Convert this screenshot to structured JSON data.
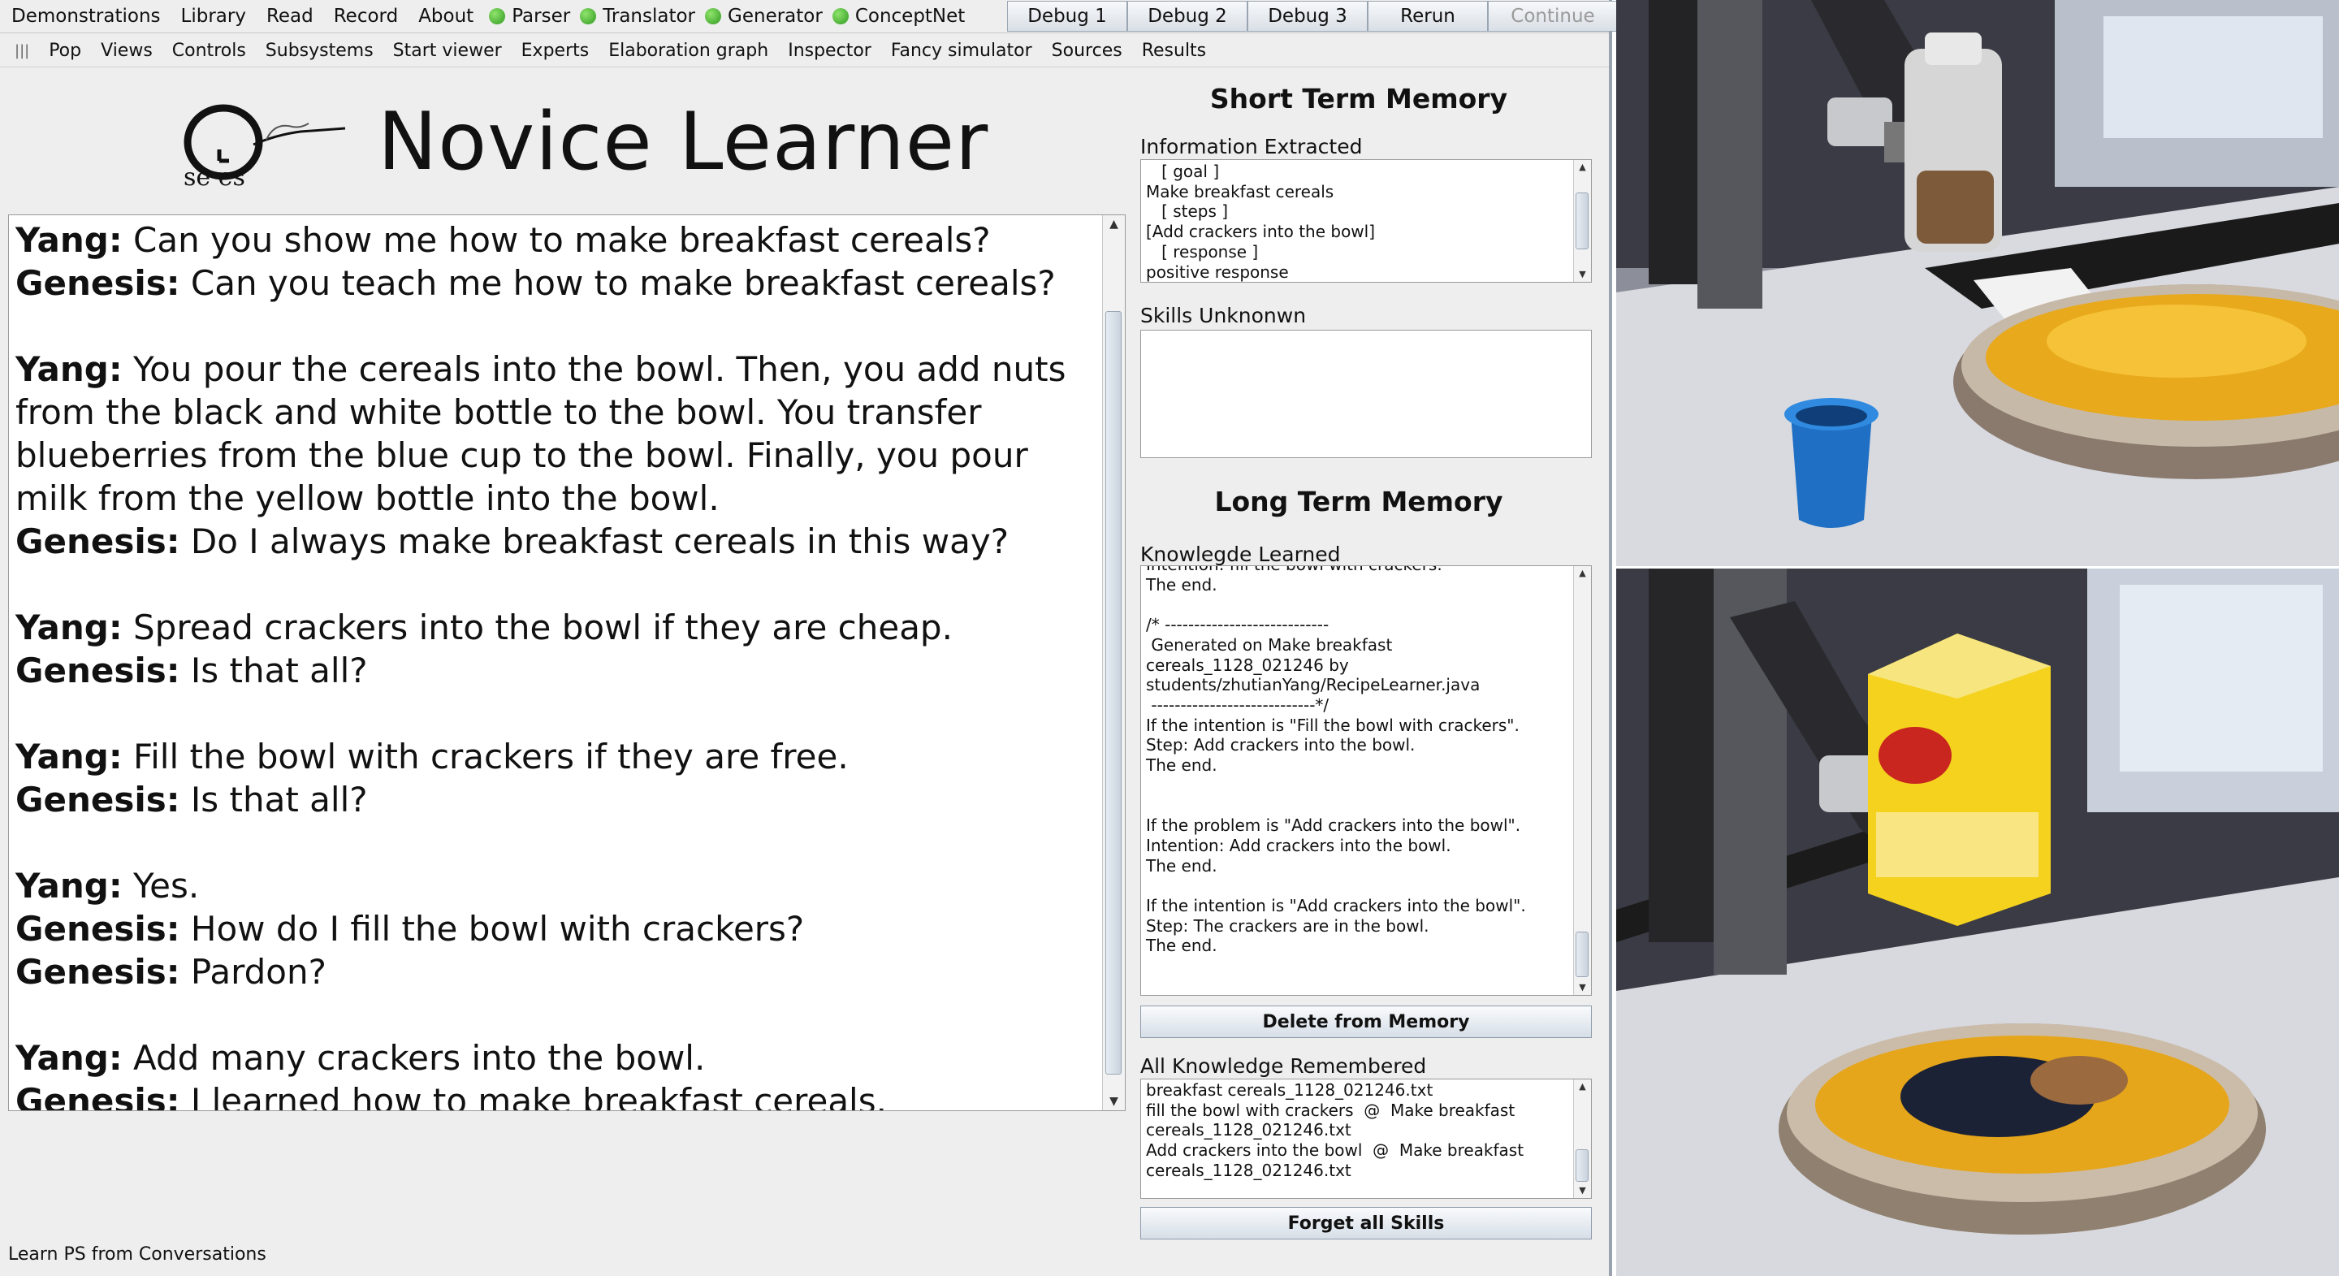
{
  "menubar": {
    "items": [
      "Demonstrations",
      "Library",
      "Read",
      "Record",
      "About"
    ],
    "status_items": [
      "Parser",
      "Translator",
      "Generator",
      "ConceptNet"
    ],
    "debug_buttons": [
      "Debug 1",
      "Debug 2",
      "Debug 3",
      "Rerun"
    ],
    "continue_label": "Continue"
  },
  "menubar2": {
    "handle": "|||",
    "items": [
      "Pop",
      "Views",
      "Controls",
      "Subsystems",
      "Start viewer",
      "Experts",
      "Elaboration graph",
      "Inspector",
      "Fancy simulator",
      "Sources",
      "Results"
    ]
  },
  "logo": {
    "text": "se es"
  },
  "title": "Novice Learner",
  "conversation": [
    {
      "speaker": "Yang:",
      "text": " Can you show me how to make breakfast cereals?"
    },
    {
      "speaker": "Genesis:",
      "text": " Can you teach me how to make breakfast cereals?"
    },
    {
      "speaker": "Yang:",
      "text": " You pour the cereals into the bowl. Then, you add nuts from the black and white bottle to the bowl. You transfer blueberries from the blue cup to the bowl. Finally, you pour milk from the yellow bottle into the bowl."
    },
    {
      "speaker": "Genesis:",
      "text": " Do I always make breakfast cereals in this way?"
    },
    {
      "speaker": "Yang:",
      "text": " Spread crackers into the bowl if they are cheap."
    },
    {
      "speaker": "Genesis:",
      "text": " Is that all?"
    },
    {
      "speaker": "Yang:",
      "text": " Fill the bowl with crackers if they are free."
    },
    {
      "speaker": "Genesis:",
      "text": " Is that all?"
    },
    {
      "speaker": "Yang:",
      "text": " Yes."
    },
    {
      "speaker": "Genesis:",
      "text": " How do I fill the bowl with crackers?"
    },
    {
      "speaker": "Genesis:",
      "text": " Pardon?"
    },
    {
      "speaker": "Yang:",
      "text": " Add many crackers into the bowl."
    },
    {
      "speaker": "Genesis:",
      "text": " I learned how to make breakfast cereals."
    }
  ],
  "status_text": "Learn PS from Conversations",
  "memory": {
    "short_term_heading": "Short Term Memory",
    "info_extracted_label": "Information Extracted",
    "info_extracted_text": "   [ goal ]\nMake breakfast cereals\n   [ steps ]\n[Add crackers into the bowl]\n   [ response ]\npositive response",
    "skills_unknown_label": "Skills Unknonwn",
    "skills_unknown_text": "",
    "long_term_heading": "Long Term Memory",
    "knowledge_learned_label": "Knowlegde Learned",
    "knowledge_learned_text": "Intention: fill the bowl with crackers.\nThe end.\n\n/* ----------------------------\n Generated on Make breakfast cereals_1128_021246 by students/zhutianYang/RecipeLearner.java\n ----------------------------*/\nIf the intention is \"Fill the bowl with crackers\".\nStep: Add crackers into the bowl.\nThe end.\n\n\nIf the problem is \"Add crackers into the bowl\".\nIntention: Add crackers into the bowl.\nThe end.\n\nIf the intention is \"Add crackers into the bowl\".\nStep: The crackers are in the bowl.\nThe end.",
    "delete_button": "Delete from Memory",
    "all_knowledge_label": "All Knowledge Remembered",
    "all_knowledge_text": "breakfast cereals_1128_021246.txt\nfill the bowl with crackers  @  Make breakfast cereals_1128_021246.txt\nAdd crackers into the bowl  @  Make breakfast cereals_1128_021246.txt",
    "forget_button": "Forget all Skills"
  },
  "colors": {
    "status_green": "#2f9a1f",
    "panel_bg": "#eeeeee",
    "cereal_yellow": "#f0b420",
    "cup_blue": "#1e7bd6"
  },
  "icons": [
    "status-dot-icon",
    "scroll-up-icon",
    "scroll-down-icon",
    "genesis-logo-icon"
  ]
}
